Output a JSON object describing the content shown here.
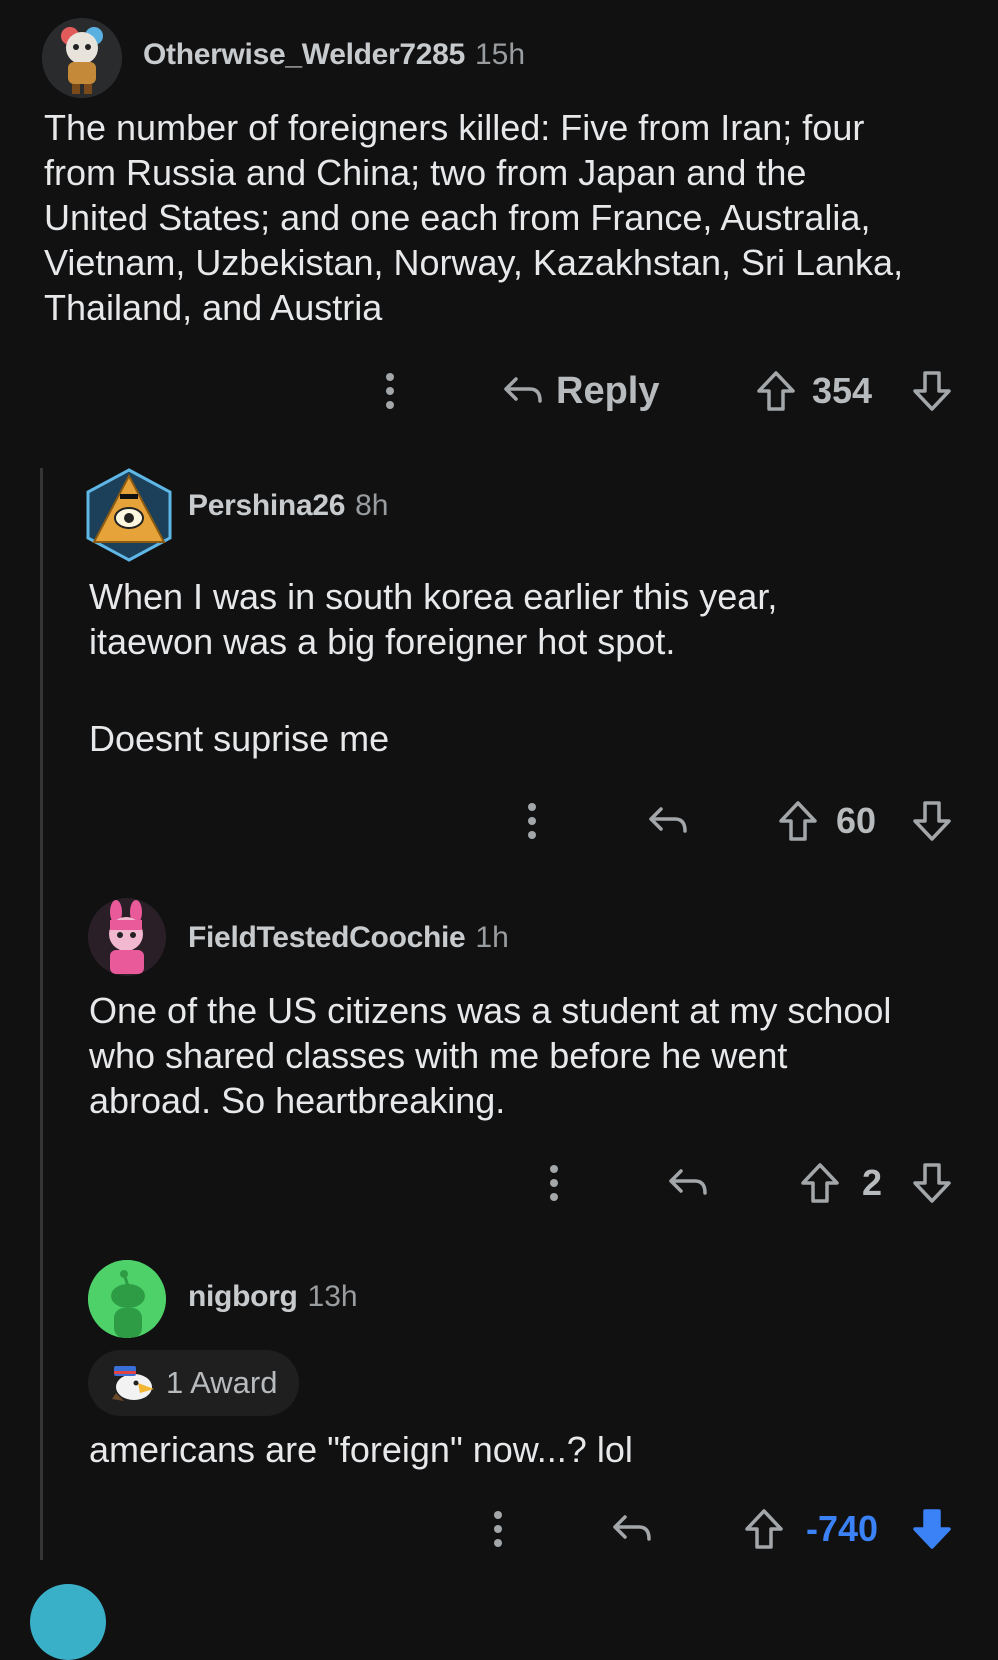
{
  "comments": [
    {
      "username": "Otherwise_Welder7285",
      "time": "15h",
      "lines": [
        "The number of foreigners killed: Five from Iran; four",
        "from Russia and China; two from Japan and the",
        "United States; and one each from France, Australia,",
        "Vietnam, Uzbekistan, Norway, Kazakhstan, Sri Lanka,",
        "Thailand, and Austria"
      ],
      "reply_label": "Reply",
      "score": "354"
    },
    {
      "username": "Pershina26",
      "time": "8h",
      "lines": [
        "When I was in south korea earlier this year,",
        "itaewon was a big foreigner hot spot.",
        "",
        "Doesnt suprise me"
      ],
      "score": "60"
    },
    {
      "username": "FieldTestedCoochie",
      "time": "1h",
      "lines": [
        "One of the US citizens was a student at my school",
        "who shared classes with me before he went",
        "abroad. So heartbreaking."
      ],
      "score": "2"
    },
    {
      "username": "nigborg",
      "time": "13h",
      "award": "1 Award",
      "lines": [
        "americans are \"foreign\" now...? lol"
      ],
      "score": "-740",
      "score_color": "#3b82f6"
    }
  ],
  "colors": {
    "background": "#111112",
    "downvote_active": "#3b82f6",
    "thread_line": "#343536"
  }
}
